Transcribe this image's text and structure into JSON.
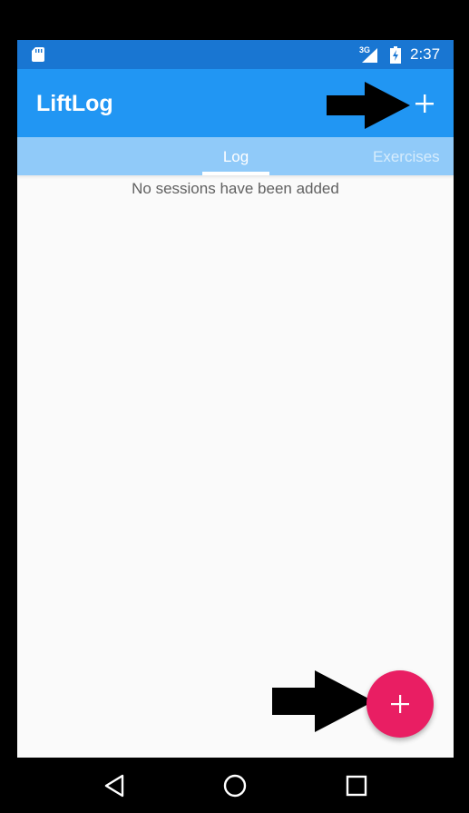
{
  "status_bar": {
    "network": "3G",
    "time": "2:37",
    "icons": [
      "sd-card-icon",
      "signal-icon",
      "battery-icon"
    ]
  },
  "app_bar": {
    "title": "LiftLog",
    "action_icon": "plus-icon",
    "background": "#2196f3"
  },
  "tabs": [
    {
      "label": "Log",
      "selected": true
    },
    {
      "label": "Exercises",
      "selected": false
    }
  ],
  "main": {
    "empty_message": "No sessions have been added"
  },
  "fab": {
    "icon": "plus-icon",
    "color": "#e91e63"
  },
  "nav_bar": {
    "icons": [
      "back-icon",
      "home-icon",
      "recents-icon"
    ]
  }
}
